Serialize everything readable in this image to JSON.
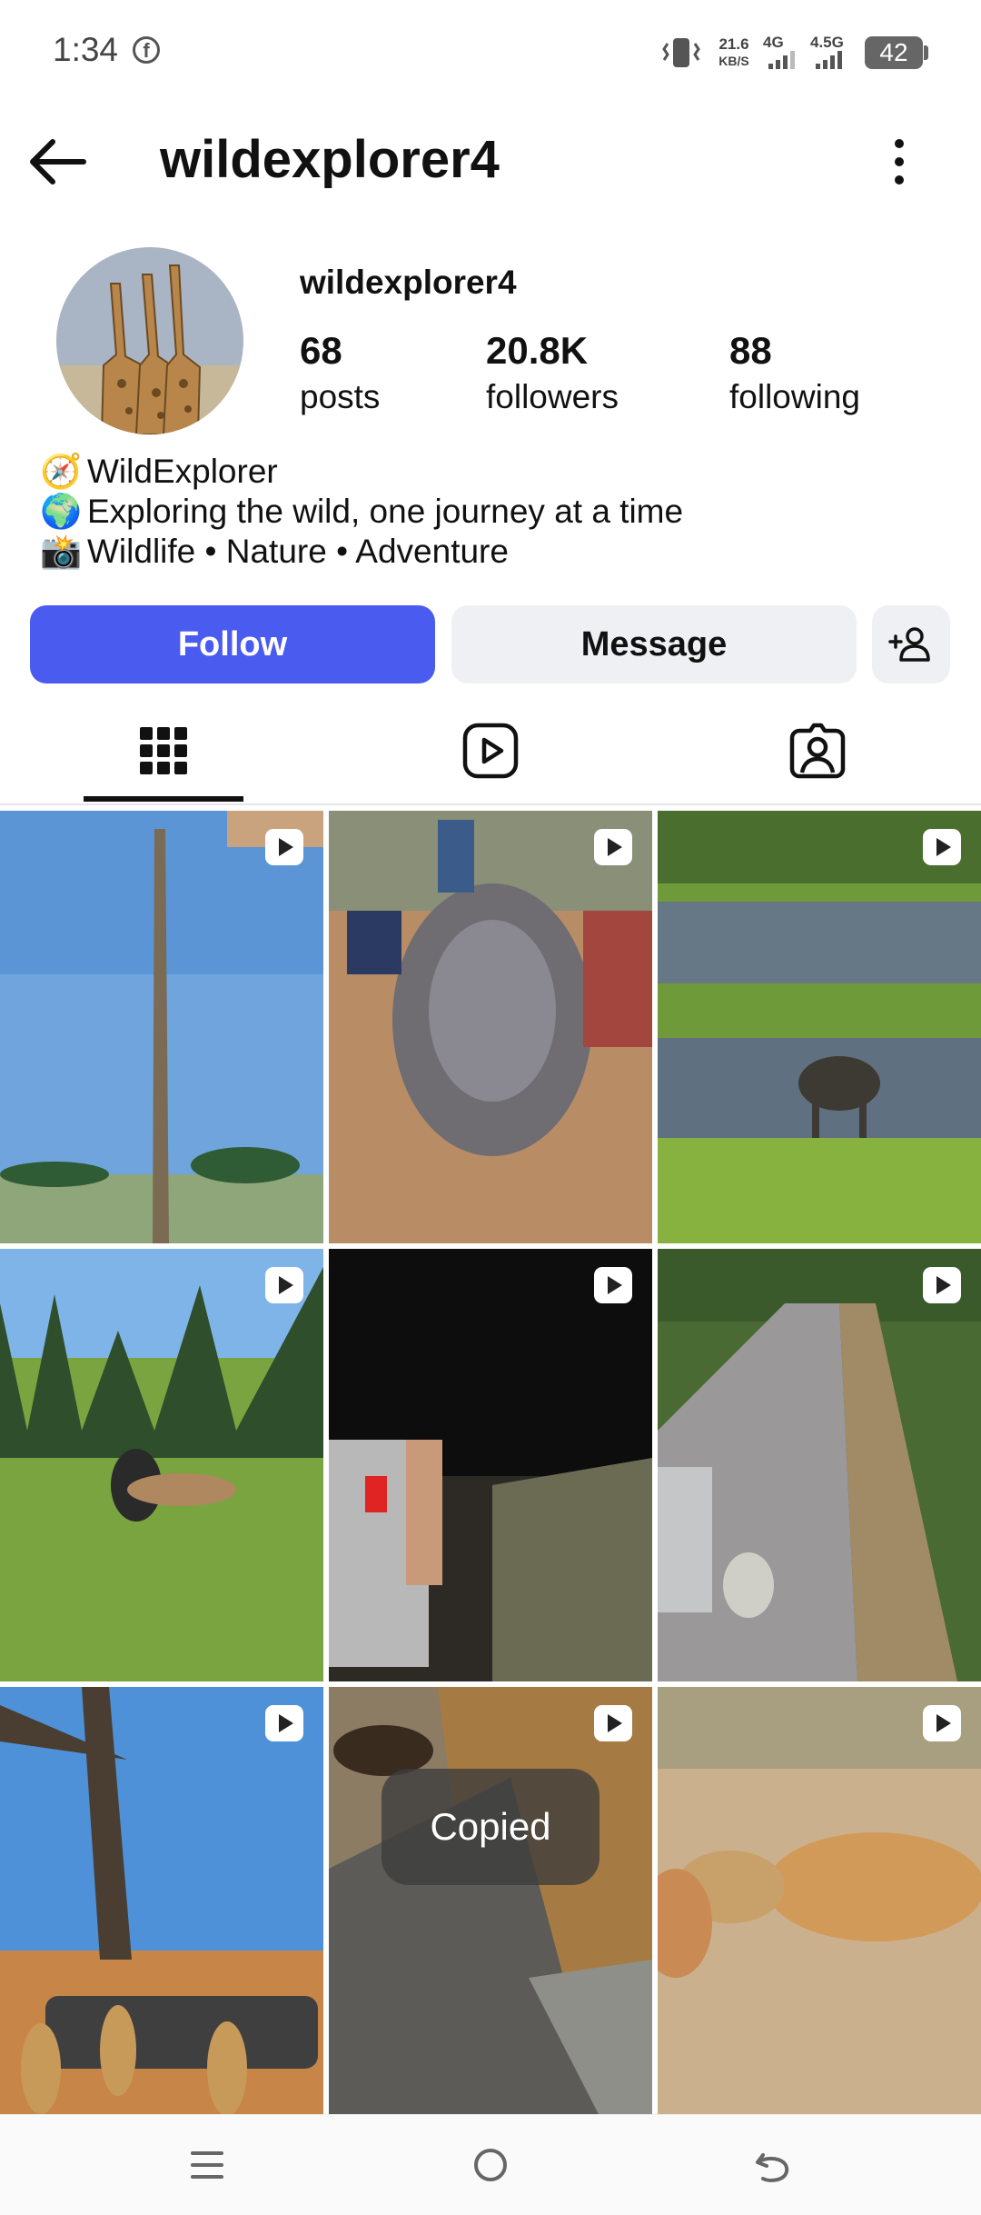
{
  "status_bar": {
    "time": "1:34",
    "network_speed_value": "21.6",
    "network_speed_unit": "KB/S",
    "signal_1": "4G",
    "signal_2": "4.5G",
    "battery": "42"
  },
  "header": {
    "title": "wildexplorer4"
  },
  "profile": {
    "username": "wildexplorer4",
    "stats": [
      {
        "value": "68",
        "label": "posts"
      },
      {
        "value": "20.8K",
        "label": "followers"
      },
      {
        "value": "88",
        "label": "following"
      }
    ],
    "bio": [
      {
        "icon": "🧭",
        "text": "WildExplorer"
      },
      {
        "icon": "🌍",
        "text": "Exploring the wild, one journey at a time"
      },
      {
        "icon": "📸",
        "text": "Wildlife • Nature • Adventure"
      }
    ]
  },
  "actions": {
    "follow_label": "Follow",
    "message_label": "Message"
  },
  "tabs": [
    "grid-icon",
    "reels-icon",
    "tagged-icon"
  ],
  "grid_posts": [
    {
      "type": "reel",
      "subject": "tall palm trunk"
    },
    {
      "type": "reel",
      "subject": "large catfish"
    },
    {
      "type": "reel",
      "subject": "wildebeest at pond"
    },
    {
      "type": "reel",
      "subject": "animals on meadow"
    },
    {
      "type": "reel",
      "subject": "car at night"
    },
    {
      "type": "reel",
      "subject": "man by car on road"
    },
    {
      "type": "reel",
      "subject": "lions under tree"
    },
    {
      "type": "reel",
      "subject": "eagle on rocks"
    },
    {
      "type": "reel",
      "subject": "leopards on sand"
    }
  ],
  "toast": {
    "text": "Copied"
  },
  "colors": {
    "accent": "#4a5bf0",
    "secondary_button": "#eff0f4"
  }
}
